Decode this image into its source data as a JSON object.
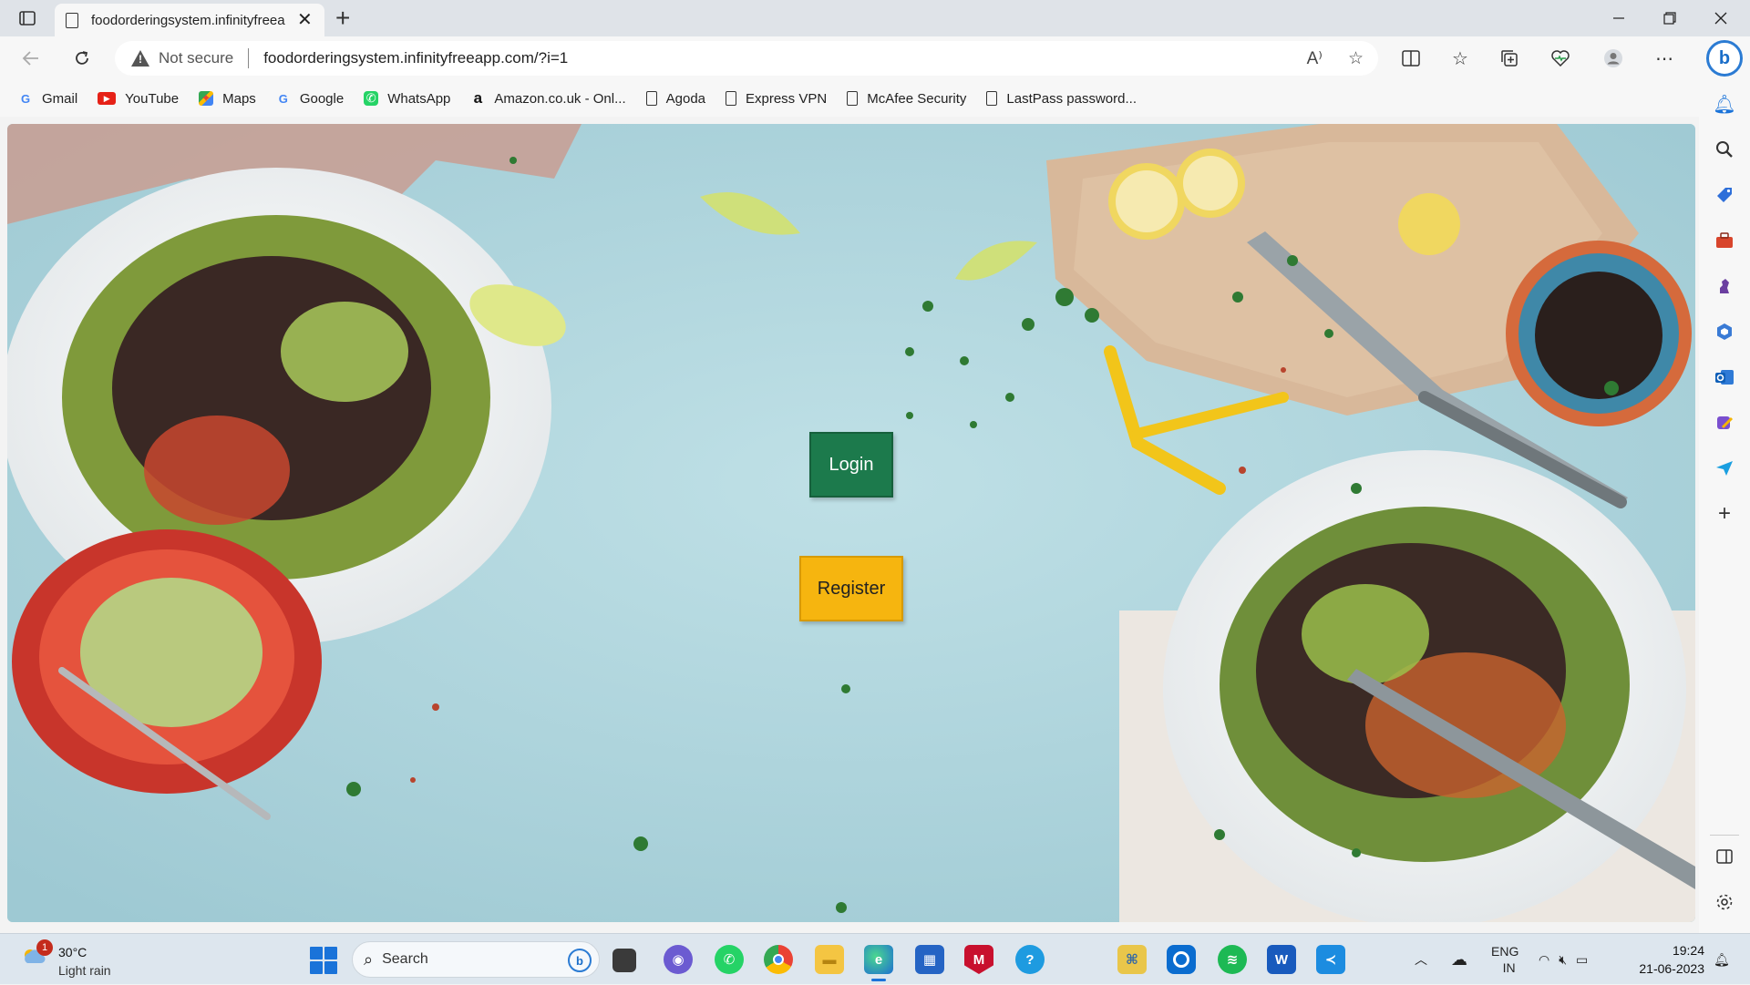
{
  "browser": {
    "tab_title": "foodorderingsystem.infinityfreea",
    "tab_close": "✕",
    "new_tab": "+",
    "not_secure": "Not secure",
    "url": "foodorderingsystem.infinityfreeapp.com/?i=1"
  },
  "bookmarks": [
    {
      "label": "Gmail",
      "icon": "google-icon",
      "glyph": "G",
      "color": "#4285f4"
    },
    {
      "label": "YouTube",
      "icon": "youtube-icon",
      "glyph": "▶",
      "color": "#e62117"
    },
    {
      "label": "Maps",
      "icon": "maps-icon",
      "glyph": "✦",
      "color": "#34a853"
    },
    {
      "label": "Google",
      "icon": "google-icon",
      "glyph": "G",
      "color": "#4285f4"
    },
    {
      "label": "WhatsApp",
      "icon": "whatsapp-icon",
      "glyph": "✆",
      "color": "#25d366"
    },
    {
      "label": "Amazon.co.uk - Onl...",
      "icon": "amazon-icon",
      "glyph": "a",
      "color": "#111111"
    },
    {
      "label": "Agoda",
      "icon": "page-icon",
      "glyph": "",
      "color": ""
    },
    {
      "label": "Express VPN",
      "icon": "page-icon",
      "glyph": "",
      "color": ""
    },
    {
      "label": "McAfee Security",
      "icon": "page-icon",
      "glyph": "",
      "color": ""
    },
    {
      "label": "LastPass password...",
      "icon": "page-icon",
      "glyph": "",
      "color": ""
    }
  ],
  "page": {
    "login_label": "Login",
    "register_label": "Register",
    "login_color": "#1c7a4c",
    "register_color": "#f6b50f"
  },
  "taskbar": {
    "weather_badge": "1",
    "temperature": "30°C",
    "condition": "Light rain",
    "search_label": "Search",
    "lang_top": "ENG",
    "lang_bottom": "IN",
    "time": "19:24",
    "date": "21-06-2023"
  }
}
